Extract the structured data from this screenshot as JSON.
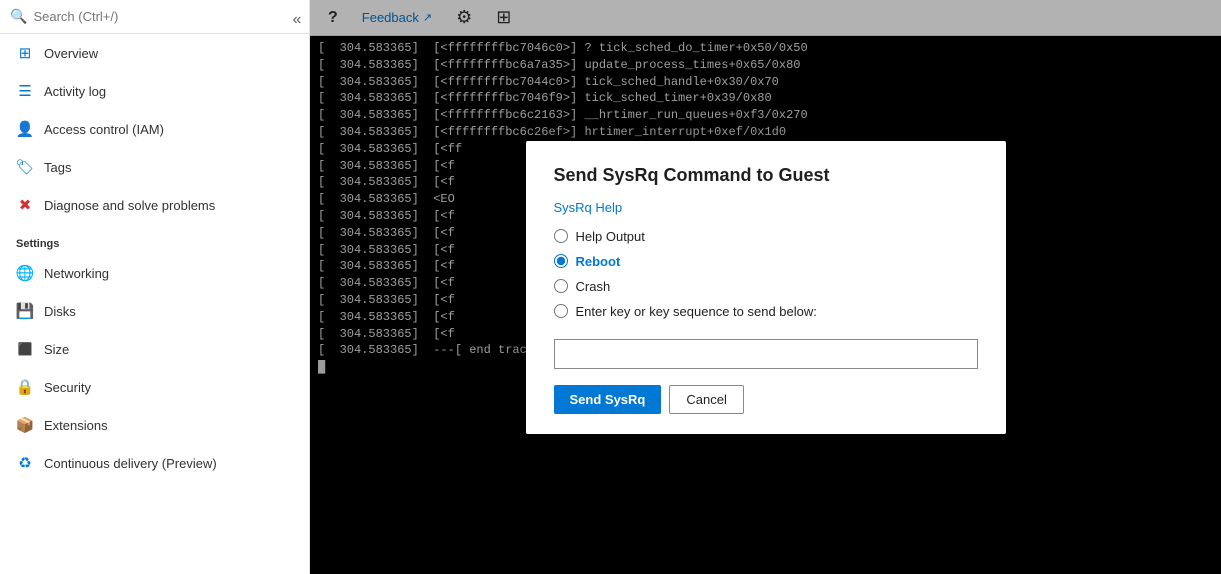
{
  "sidebar": {
    "search_placeholder": "Search (Ctrl+/)",
    "collapse_icon": "«",
    "items_top": [
      {
        "id": "overview",
        "label": "Overview",
        "icon": "⊞"
      },
      {
        "id": "activity-log",
        "label": "Activity log",
        "icon": "≡"
      },
      {
        "id": "access-control",
        "label": "Access control (IAM)",
        "icon": "👤"
      },
      {
        "id": "tags",
        "label": "Tags",
        "icon": "🏷"
      },
      {
        "id": "diagnose",
        "label": "Diagnose and solve problems",
        "icon": "✖"
      }
    ],
    "settings_title": "Settings",
    "items_settings": [
      {
        "id": "networking",
        "label": "Networking",
        "icon": "🌐"
      },
      {
        "id": "disks",
        "label": "Disks",
        "icon": "💾"
      },
      {
        "id": "size",
        "label": "Size",
        "icon": "⬛"
      },
      {
        "id": "security",
        "label": "Security",
        "icon": "🔒"
      },
      {
        "id": "extensions",
        "label": "Extensions",
        "icon": "📦"
      },
      {
        "id": "continuous-delivery",
        "label": "Continuous delivery (Preview)",
        "icon": "♻"
      }
    ]
  },
  "toolbar": {
    "help_label": "?",
    "feedback_label": "Feedback",
    "feedback_icon": "↗",
    "settings_icon": "⚙",
    "grid_icon": "⊞"
  },
  "terminal": {
    "lines": [
      "[  304.583365]  [<ffffffffbc7046c0>] ? tick_sched_do_timer+0x50/0x50",
      "[  304.583365]  [<ffffffffbc6a7a35>] update_process_times+0x65/0x80",
      "[  304.583365]  [<ffffffffbc7044c0>] tick_sched_handle+0x30/0x70",
      "[  304.583365]  [<ffffffffbc7046f9>] tick_sched_timer+0x39/0x80",
      "[  304.583365]  [<ffffffffbc6c2163>] __hrtimer_run_queues+0xf3/0x270",
      "[  304.583365]  [<ffffffffbc6c26ef>] hrtimer_interrupt+0xef/0x1d0",
      "[  304.583365]  [<ff",
      "[  304.583365]  [<f",
      "[  304.583365]  [<f",
      "[  304.583365]  <EO",
      "[  304.583365]  [<f",
      "[  304.583365]  [<f",
      "[  304.583365]  [<f",
      "[  304.583365]  [<f",
      "[  304.583365]  [<f",
      "[  304.583365]  [<f",
      "[  304.583365]  [<f",
      "[  304.583365]  [<f",
      "[  304.583365]  ---[ end trace e62c772609caab2c ]---"
    ]
  },
  "modal": {
    "title": "Send SysRq Command to Guest",
    "help_link": "SysRq Help",
    "radio_options": [
      {
        "id": "help-output",
        "label": "Help Output",
        "checked": false
      },
      {
        "id": "reboot",
        "label": "Reboot",
        "checked": true
      },
      {
        "id": "crash",
        "label": "Crash",
        "checked": false
      },
      {
        "id": "key-sequence",
        "label": "Enter key or key sequence to send below:",
        "checked": false
      }
    ],
    "key_input_placeholder": "",
    "send_button_label": "Send SysRq",
    "cancel_button_label": "Cancel"
  }
}
